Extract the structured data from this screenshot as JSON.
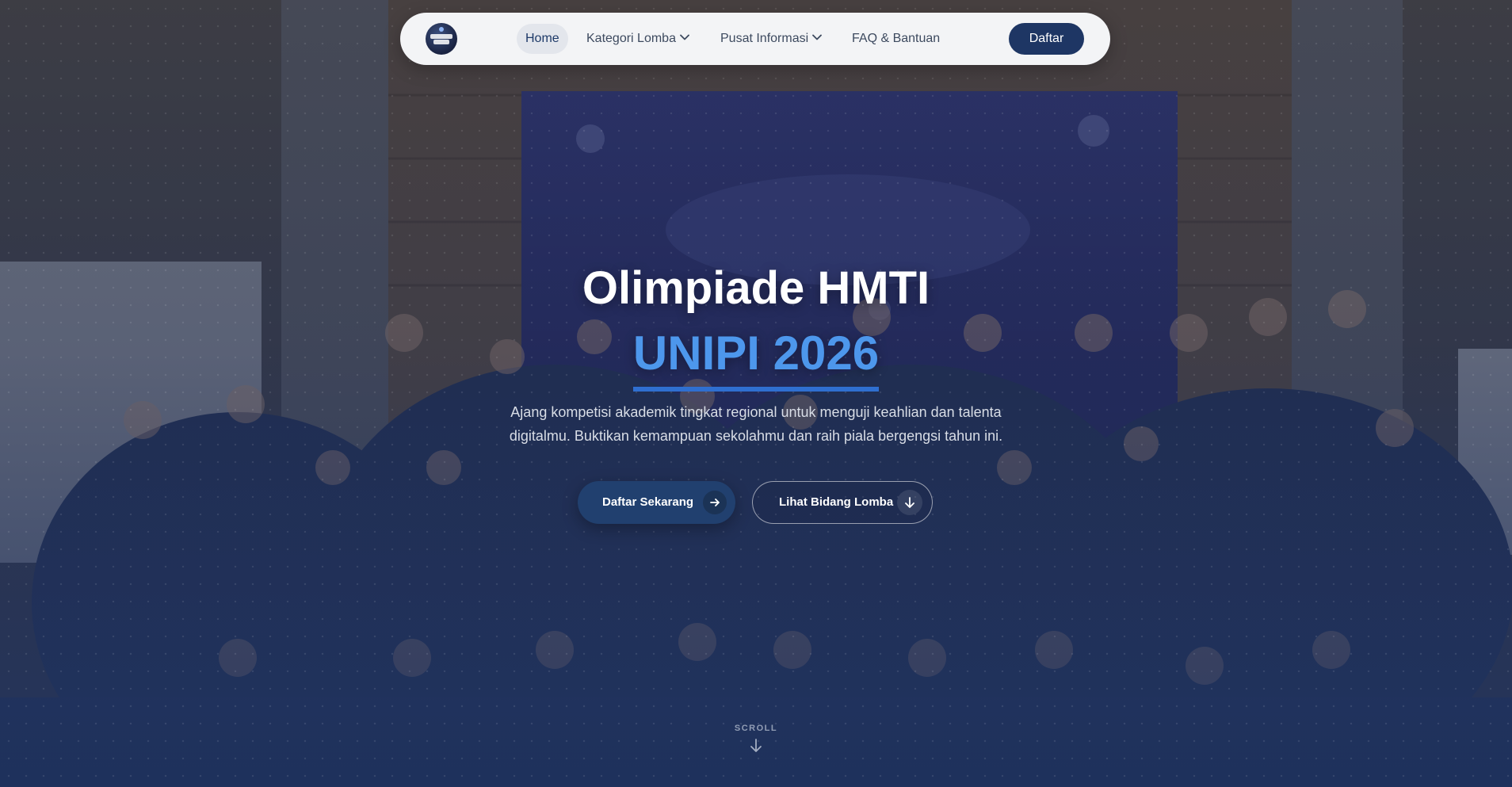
{
  "nav": {
    "logo_alt": "OLIMPIADE HMTI",
    "items": [
      {
        "label": "Home"
      },
      {
        "label": "Kategori Lomba"
      },
      {
        "label": "Pusat Informasi"
      },
      {
        "label": "FAQ & Bantuan"
      }
    ],
    "cta_label": "Daftar"
  },
  "hero": {
    "title": "Olimpiade HMTI",
    "subtitle": "UNIPI 2026",
    "description": "Ajang kompetisi akademik tingkat regional untuk menguji keahlian dan talenta digitalmu. Buktikan kemampuan sekolahmu dan raih piala bergengsi tahun ini.",
    "primary_button": "Daftar Sekarang",
    "secondary_button": "Lihat Bidang Lomba"
  },
  "scroll_label": "SCROLL",
  "colors": {
    "navbar_bg": "#f3f4f6",
    "primary": "#1e3664",
    "accent": "#4d97ec",
    "underline": "#2f6fd0"
  },
  "icons": {
    "nav_dropdown": "chevron-down-icon",
    "primary_button": "arrow-right-icon",
    "secondary_button": "arrow-down-icon",
    "scroll": "arrow-down-icon"
  }
}
